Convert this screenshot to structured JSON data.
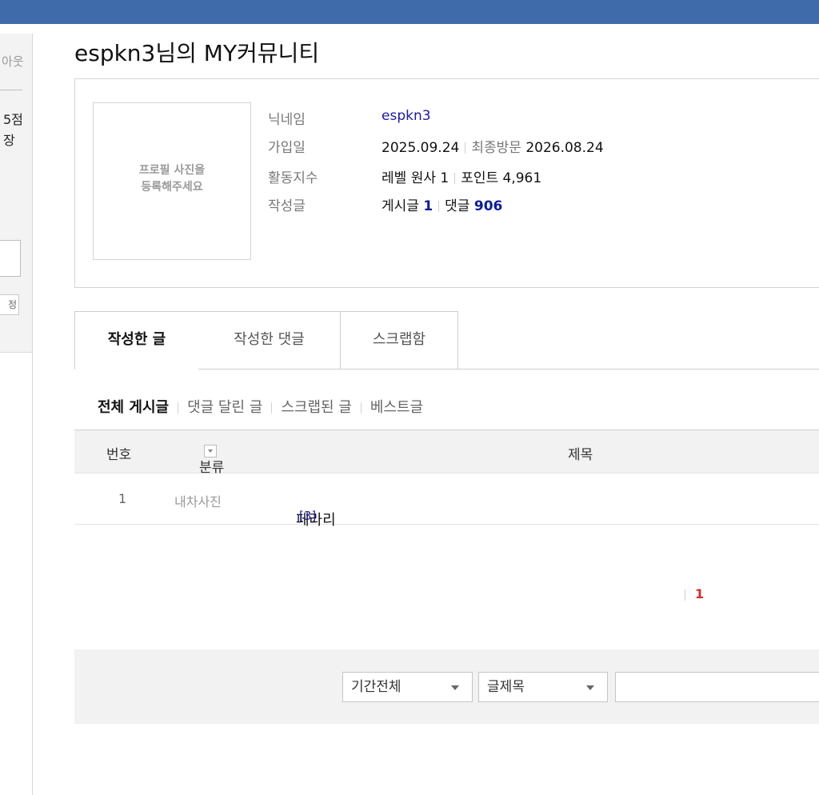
{
  "sidebar": {
    "logout": "아웃",
    "line1": "5점",
    "line2": "장",
    "button": "정"
  },
  "page_title": "espkn3님의 MY커뮤니티",
  "profile": {
    "photo_text_line1": "프로필 사진을",
    "photo_text_line2": "등록해주세요",
    "labels": {
      "nickname": "닉네임",
      "joined": "가입일",
      "activity": "활동지수",
      "posts": "작성글"
    },
    "nickname": "espkn3",
    "joined_date": "2025.09.24",
    "last_visit_label": "최종방문",
    "last_visit_date": "2026.08.24",
    "level_label": "레벨",
    "level_value": "원사 1",
    "points_label": "포인트",
    "points_value": "4,961",
    "post_label": "게시글",
    "post_count": "1",
    "comment_label": "댓글",
    "comment_count": "906"
  },
  "tabs": [
    "작성한 글",
    "작성한 댓글",
    "스크랩함"
  ],
  "subnav": [
    "전체 게시글",
    "댓글 달린 글",
    "스크랩된 글",
    "베스트글"
  ],
  "table": {
    "headers": {
      "no": "번호",
      "category": "분류",
      "title": "제목"
    },
    "rows": [
      {
        "no": "1",
        "category": "내차사진",
        "title": "페라리",
        "comments": "[3]"
      }
    ]
  },
  "pager": {
    "current": "1"
  },
  "search": {
    "period": "기간전체",
    "field": "글제목",
    "query": ""
  },
  "colors": {
    "topbar": "#3f6bab",
    "link_blue": "#1a1aa8",
    "current_page": "#d52a2a"
  }
}
